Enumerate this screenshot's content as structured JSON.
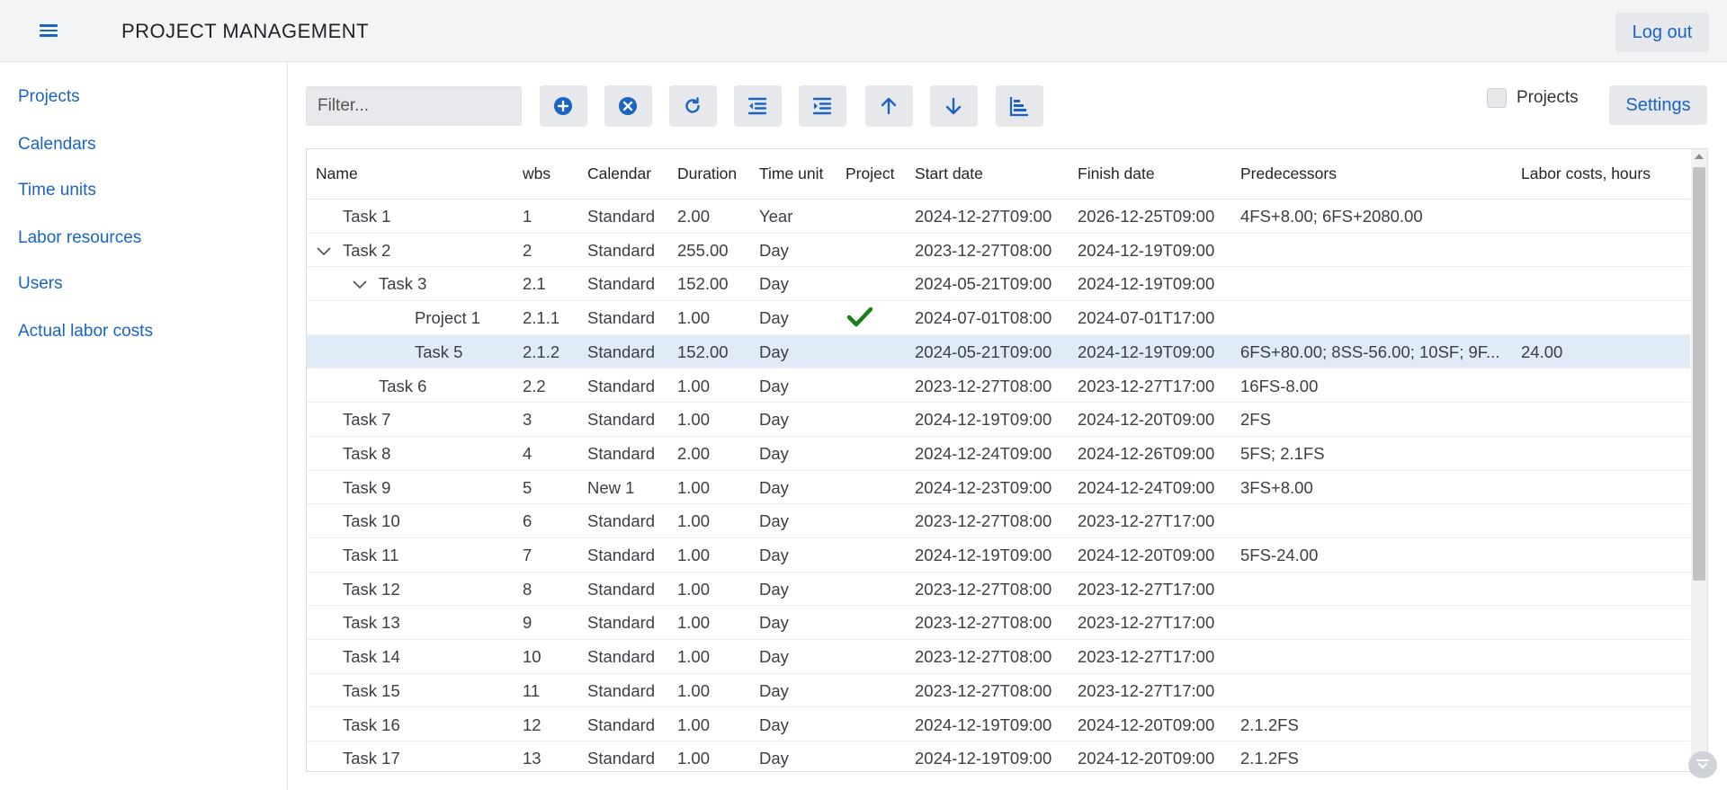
{
  "header": {
    "title": "PROJECT MANAGEMENT",
    "logout_label": "Log out"
  },
  "sidebar": {
    "items": [
      {
        "label": "Projects"
      },
      {
        "label": "Calendars"
      },
      {
        "label": "Time units"
      },
      {
        "label": "Labor resources"
      },
      {
        "label": "Users"
      },
      {
        "label": "Actual labor costs"
      }
    ]
  },
  "toolbar": {
    "filter_placeholder": "Filter...",
    "buttons": [
      "plus-circle-icon",
      "x-circle-icon",
      "refresh-icon",
      "outdent-icon",
      "indent-icon",
      "arrow-up-icon",
      "arrow-down-icon",
      "gantt-icon"
    ],
    "projects_checkbox_label": "Projects",
    "projects_checked": false,
    "settings_label": "Settings"
  },
  "colors": {
    "accent": "#1a64c4",
    "selected_row": "#e1ebf7",
    "check": "#1a7f1a"
  },
  "table": {
    "columns": [
      "Name",
      "wbs",
      "Calendar",
      "Duration",
      "Time unit",
      "Project",
      "Start date",
      "Finish date",
      "Predecessors",
      "Labor costs, hours"
    ],
    "rows": [
      {
        "name": "Task 1",
        "level": 0,
        "expandable": false,
        "wbs": "1",
        "calendar": "Standard",
        "duration": "2.00",
        "unit": "Year",
        "project": false,
        "start": "2024-12-27T09:00",
        "finish": "2026-12-25T09:00",
        "pred": "4FS+8.00; 6FS+2080.00",
        "labor": ""
      },
      {
        "name": "Task 2",
        "level": 0,
        "expandable": true,
        "wbs": "2",
        "calendar": "Standard",
        "duration": "255.00",
        "unit": "Day",
        "project": false,
        "start": "2023-12-27T08:00",
        "finish": "2024-12-19T09:00",
        "pred": "",
        "labor": ""
      },
      {
        "name": "Task 3",
        "level": 1,
        "expandable": true,
        "wbs": "2.1",
        "calendar": "Standard",
        "duration": "152.00",
        "unit": "Day",
        "project": false,
        "start": "2024-05-21T09:00",
        "finish": "2024-12-19T09:00",
        "pred": "",
        "labor": ""
      },
      {
        "name": "Project 1",
        "level": 2,
        "expandable": false,
        "wbs": "2.1.1",
        "calendar": "Standard",
        "duration": "1.00",
        "unit": "Day",
        "project": true,
        "start": "2024-07-01T08:00",
        "finish": "2024-07-01T17:00",
        "pred": "",
        "labor": ""
      },
      {
        "name": "Task 5",
        "level": 2,
        "expandable": false,
        "selected": true,
        "wbs": "2.1.2",
        "calendar": "Standard",
        "duration": "152.00",
        "unit": "Day",
        "project": false,
        "start": "2024-05-21T09:00",
        "finish": "2024-12-19T09:00",
        "pred": "6FS+80.00; 8SS-56.00; 10SF; 9F...",
        "labor": "24.00"
      },
      {
        "name": "Task 6",
        "level": 1,
        "expandable": false,
        "wbs": "2.2",
        "calendar": "Standard",
        "duration": "1.00",
        "unit": "Day",
        "project": false,
        "start": "2023-12-27T08:00",
        "finish": "2023-12-27T17:00",
        "pred": "16FS-8.00",
        "labor": ""
      },
      {
        "name": "Task 7",
        "level": 0,
        "expandable": false,
        "wbs": "3",
        "calendar": "Standard",
        "duration": "1.00",
        "unit": "Day",
        "project": false,
        "start": "2024-12-19T09:00",
        "finish": "2024-12-20T09:00",
        "pred": "2FS",
        "labor": ""
      },
      {
        "name": "Task 8",
        "level": 0,
        "expandable": false,
        "wbs": "4",
        "calendar": "Standard",
        "duration": "2.00",
        "unit": "Day",
        "project": false,
        "start": "2024-12-24T09:00",
        "finish": "2024-12-26T09:00",
        "pred": "5FS; 2.1FS",
        "labor": ""
      },
      {
        "name": "Task 9",
        "level": 0,
        "expandable": false,
        "wbs": "5",
        "calendar": "New 1",
        "duration": "1.00",
        "unit": "Day",
        "project": false,
        "start": "2024-12-23T09:00",
        "finish": "2024-12-24T09:00",
        "pred": "3FS+8.00",
        "labor": ""
      },
      {
        "name": "Task 10",
        "level": 0,
        "expandable": false,
        "wbs": "6",
        "calendar": "Standard",
        "duration": "1.00",
        "unit": "Day",
        "project": false,
        "start": "2023-12-27T08:00",
        "finish": "2023-12-27T17:00",
        "pred": "",
        "labor": ""
      },
      {
        "name": "Task 11",
        "level": 0,
        "expandable": false,
        "wbs": "7",
        "calendar": "Standard",
        "duration": "1.00",
        "unit": "Day",
        "project": false,
        "start": "2024-12-19T09:00",
        "finish": "2024-12-20T09:00",
        "pred": "5FS-24.00",
        "labor": ""
      },
      {
        "name": "Task 12",
        "level": 0,
        "expandable": false,
        "wbs": "8",
        "calendar": "Standard",
        "duration": "1.00",
        "unit": "Day",
        "project": false,
        "start": "2023-12-27T08:00",
        "finish": "2023-12-27T17:00",
        "pred": "",
        "labor": ""
      },
      {
        "name": "Task 13",
        "level": 0,
        "expandable": false,
        "wbs": "9",
        "calendar": "Standard",
        "duration": "1.00",
        "unit": "Day",
        "project": false,
        "start": "2023-12-27T08:00",
        "finish": "2023-12-27T17:00",
        "pred": "",
        "labor": ""
      },
      {
        "name": "Task 14",
        "level": 0,
        "expandable": false,
        "wbs": "10",
        "calendar": "Standard",
        "duration": "1.00",
        "unit": "Day",
        "project": false,
        "start": "2023-12-27T08:00",
        "finish": "2023-12-27T17:00",
        "pred": "",
        "labor": ""
      },
      {
        "name": "Task 15",
        "level": 0,
        "expandable": false,
        "wbs": "11",
        "calendar": "Standard",
        "duration": "1.00",
        "unit": "Day",
        "project": false,
        "start": "2023-12-27T08:00",
        "finish": "2023-12-27T17:00",
        "pred": "",
        "labor": ""
      },
      {
        "name": "Task 16",
        "level": 0,
        "expandable": false,
        "wbs": "12",
        "calendar": "Standard",
        "duration": "1.00",
        "unit": "Day",
        "project": false,
        "start": "2024-12-19T09:00",
        "finish": "2024-12-20T09:00",
        "pred": "2.1.2FS",
        "labor": ""
      },
      {
        "name": "Task 17",
        "level": 0,
        "expandable": false,
        "wbs": "13",
        "calendar": "Standard",
        "duration": "1.00",
        "unit": "Day",
        "project": false,
        "start": "2024-12-19T09:00",
        "finish": "2024-12-20T09:00",
        "pred": "2.1.2FS",
        "labor": ""
      }
    ]
  }
}
